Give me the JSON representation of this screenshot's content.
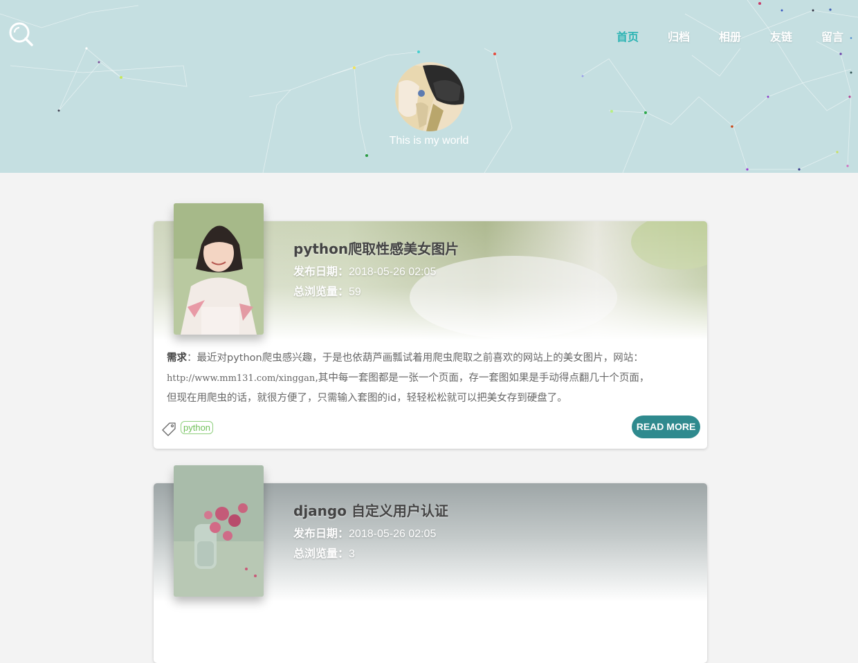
{
  "nav": {
    "items": [
      {
        "label": "首页",
        "active": true
      },
      {
        "label": "归档",
        "active": false
      },
      {
        "label": "相册",
        "active": false
      },
      {
        "label": "友链",
        "active": false
      },
      {
        "label": "留言",
        "active": false
      }
    ]
  },
  "header": {
    "search_icon": "search-icon",
    "tagline": "This is my world"
  },
  "posts": [
    {
      "title": "python爬取性感美女图片",
      "date_label": "发布日期：",
      "date": "2018-05-26 02:05",
      "views_label": "总浏览量：",
      "views": "59",
      "excerpt_bold": "需求",
      "excerpt_line1": "：最近对python爬虫感兴趣，于是也依葫芦画瓢试着用爬虫爬取之前喜欢的网站上的美女图片，网站：",
      "excerpt_url": "http://www.mm131.com/xinggan",
      "excerpt_line2": ",其中每一套图都是一张一个页面，存一套图如果是手动得点翻几十个页面，",
      "excerpt_line3": "但现在用爬虫的话，就很方便了，只需输入套图的id，轻轻松松就可以把美女存到硬盘了。",
      "tag": "python",
      "read_more": "READ MORE"
    },
    {
      "title": "django 自定义用户认证",
      "date_label": "发布日期：",
      "date": "2018-05-26 02:05",
      "views_label": "总浏览量：",
      "views": "3"
    }
  ],
  "colors": {
    "header_bg": "#c5dfe1",
    "nav_active": "#2bb3b3",
    "read_more_bg": "#2f8a8e",
    "tag_green": "#70c05a"
  }
}
